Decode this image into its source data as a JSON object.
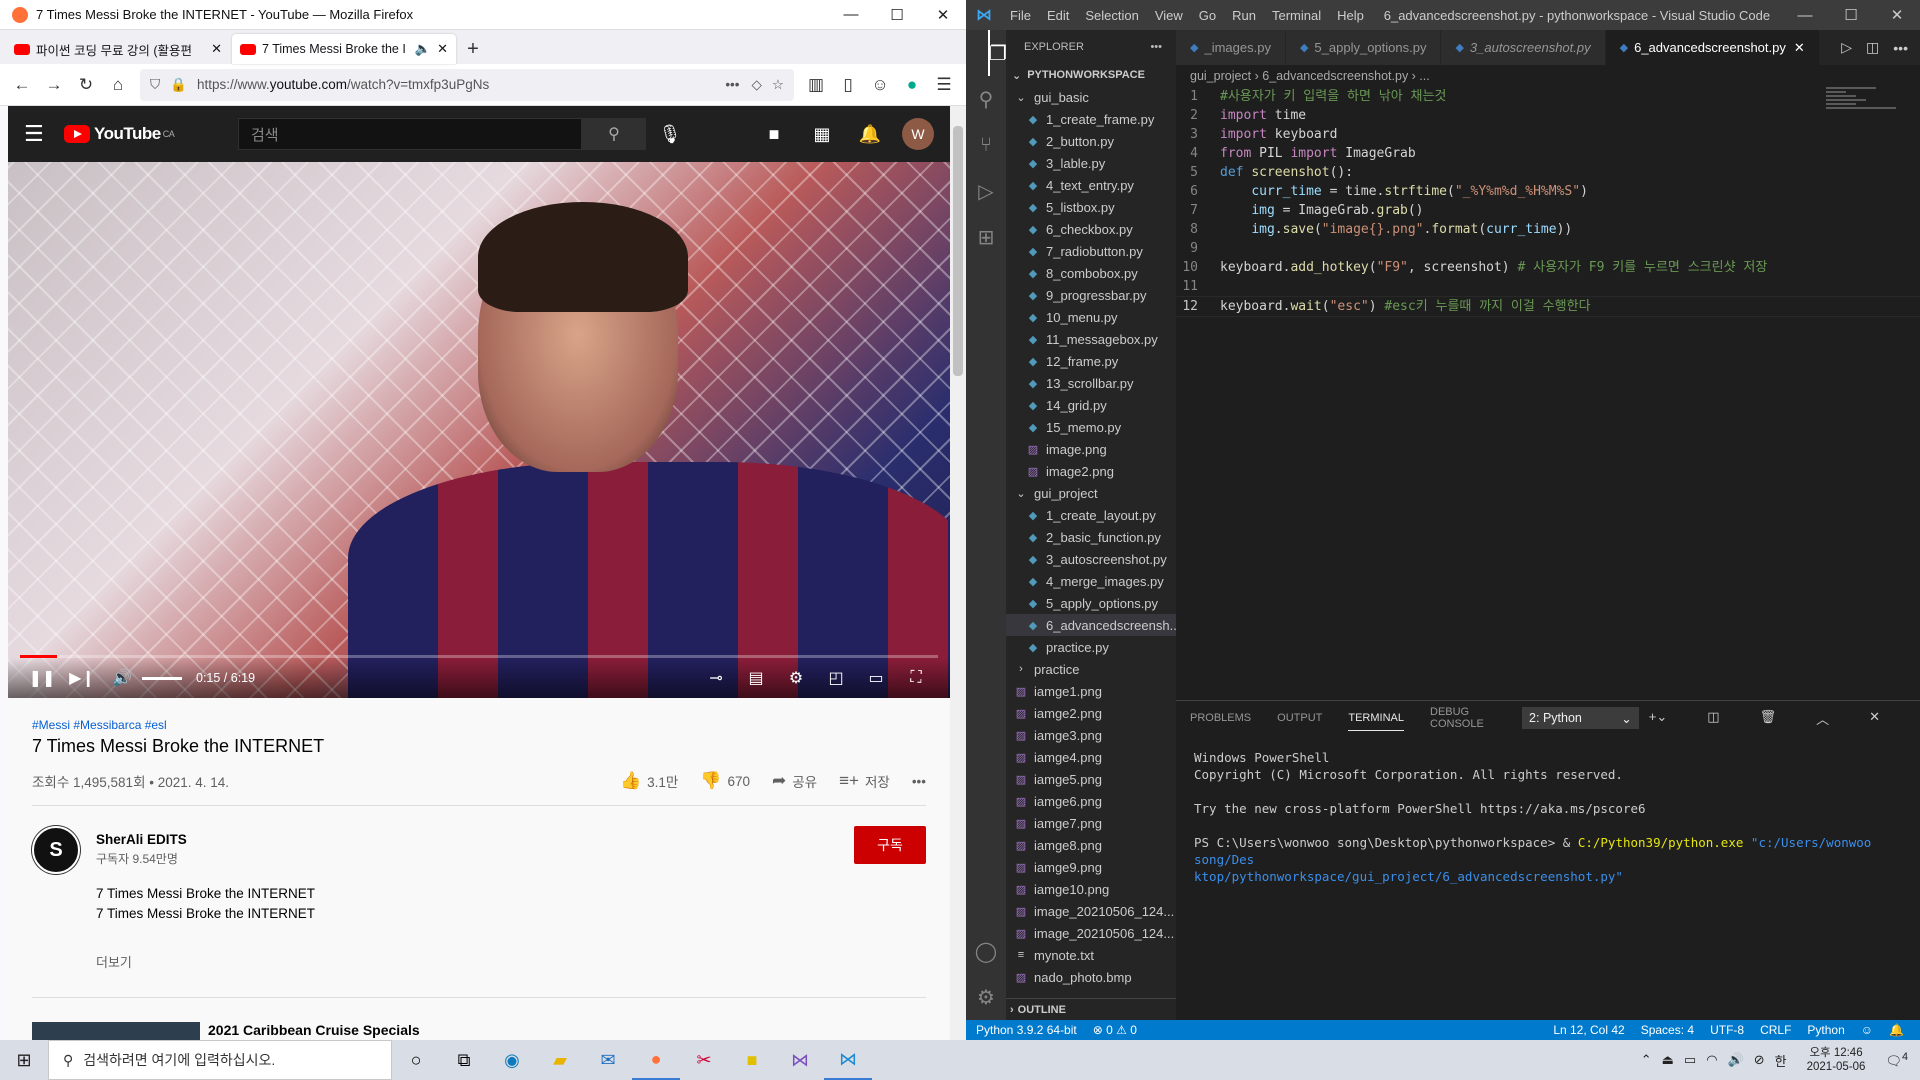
{
  "firefox": {
    "window_title": "7 Times Messi Broke the INTERNET - YouTube — Mozilla Firefox",
    "tabs": [
      {
        "label": "파이썬 코딩 무료 강의 (활용편"
      },
      {
        "label": "7 Times Messi Broke the I"
      }
    ],
    "url_prefix": "https://www.",
    "url_domain": "youtube.com",
    "url_path": "/watch?v=tmxfp3uPgNs"
  },
  "youtube": {
    "logo": "YouTube",
    "country": "CA",
    "search_placeholder": "검색",
    "avatar_letter": "W",
    "player": {
      "time": "0:15 / 6:19",
      "progress": 0.04
    },
    "tags": "#Messi #Messibarca #esl",
    "title": "7 Times Messi Broke the INTERNET",
    "views": "조회수 1,495,581회 • 2021. 4. 14.",
    "likes": "3.1만",
    "dislikes": "670",
    "share": "공유",
    "save": "저장",
    "channel_name": "SherAli EDITS",
    "subscribers": "구독자 9.54만명",
    "subscribe": "구독",
    "desc1": "7 Times Messi Broke the INTERNET",
    "desc2": "7 Times Messi Broke the INTERNET",
    "more": "더보기",
    "related_title": "2021 Caribbean Cruise Specials"
  },
  "vscode": {
    "window_title": "6_advancedscreenshot.py - pythonworkspace - Visual Studio Code",
    "menu": [
      "File",
      "Edit",
      "Selection",
      "View",
      "Go",
      "Run",
      "Terminal",
      "Help"
    ],
    "explorer_title": "EXPLORER",
    "workspace": "PYTHONWORKSPACE",
    "tree": [
      {
        "label": "gui_basic",
        "kind": "folder",
        "depth": 1
      },
      {
        "label": "1_create_frame.py",
        "kind": "py",
        "depth": 2
      },
      {
        "label": "2_button.py",
        "kind": "py",
        "depth": 2
      },
      {
        "label": "3_lable.py",
        "kind": "py",
        "depth": 2
      },
      {
        "label": "4_text_entry.py",
        "kind": "py",
        "depth": 2
      },
      {
        "label": "5_listbox.py",
        "kind": "py",
        "depth": 2
      },
      {
        "label": "6_checkbox.py",
        "kind": "py",
        "depth": 2
      },
      {
        "label": "7_radiobutton.py",
        "kind": "py",
        "depth": 2
      },
      {
        "label": "8_combobox.py",
        "kind": "py",
        "depth": 2
      },
      {
        "label": "9_progressbar.py",
        "kind": "py",
        "depth": 2
      },
      {
        "label": "10_menu.py",
        "kind": "py",
        "depth": 2
      },
      {
        "label": "11_messagebox.py",
        "kind": "py",
        "depth": 2
      },
      {
        "label": "12_frame.py",
        "kind": "py",
        "depth": 2
      },
      {
        "label": "13_scrollbar.py",
        "kind": "py",
        "depth": 2
      },
      {
        "label": "14_grid.py",
        "kind": "py",
        "depth": 2
      },
      {
        "label": "15_memo.py",
        "kind": "py",
        "depth": 2
      },
      {
        "label": "image.png",
        "kind": "img",
        "depth": 2
      },
      {
        "label": "image2.png",
        "kind": "img",
        "depth": 2
      },
      {
        "label": "gui_project",
        "kind": "folder",
        "depth": 1
      },
      {
        "label": "1_create_layout.py",
        "kind": "py",
        "depth": 2
      },
      {
        "label": "2_basic_function.py",
        "kind": "py",
        "depth": 2
      },
      {
        "label": "3_autoscreenshot.py",
        "kind": "py",
        "depth": 2
      },
      {
        "label": "4_merge_images.py",
        "kind": "py",
        "depth": 2
      },
      {
        "label": "5_apply_options.py",
        "kind": "py",
        "depth": 2
      },
      {
        "label": "6_advancedscreensh...",
        "kind": "py",
        "depth": 2,
        "selected": true
      },
      {
        "label": "practice.py",
        "kind": "py",
        "depth": 2
      },
      {
        "label": "practice",
        "kind": "folder-closed",
        "depth": 1
      },
      {
        "label": "iamge1.png",
        "kind": "img",
        "depth": 1
      },
      {
        "label": "iamge2.png",
        "kind": "img",
        "depth": 1
      },
      {
        "label": "iamge3.png",
        "kind": "img",
        "depth": 1
      },
      {
        "label": "iamge4.png",
        "kind": "img",
        "depth": 1
      },
      {
        "label": "iamge5.png",
        "kind": "img",
        "depth": 1
      },
      {
        "label": "iamge6.png",
        "kind": "img",
        "depth": 1
      },
      {
        "label": "iamge7.png",
        "kind": "img",
        "depth": 1
      },
      {
        "label": "iamge8.png",
        "kind": "img",
        "depth": 1
      },
      {
        "label": "iamge9.png",
        "kind": "img",
        "depth": 1
      },
      {
        "label": "iamge10.png",
        "kind": "img",
        "depth": 1
      },
      {
        "label": "image_20210506_124...",
        "kind": "img",
        "depth": 1
      },
      {
        "label": "image_20210506_124...",
        "kind": "img",
        "depth": 1
      },
      {
        "label": "mynote.txt",
        "kind": "txt",
        "depth": 1
      },
      {
        "label": "nado_photo.bmp",
        "kind": "img",
        "depth": 1
      }
    ],
    "outline": "OUTLINE",
    "editor_tabs": [
      {
        "label": "_images.py",
        "current": false,
        "italic": false
      },
      {
        "label": "5_apply_options.py",
        "current": false,
        "italic": false
      },
      {
        "label": "3_autoscreenshot.py",
        "current": false,
        "italic": true
      },
      {
        "label": "6_advancedscreenshot.py",
        "current": true,
        "italic": false
      }
    ],
    "breadcrumb": "gui_project  ›  6_advancedscreenshot.py  ›  ...",
    "code": [
      "#사용자가 키 입력을 하면 낚아 채는것",
      "import time",
      "import keyboard",
      "from PIL import ImageGrab",
      "def screenshot():",
      "    curr_time = time.strftime(\"_%Y%m%d_%H%M%S\")",
      "    img = ImageGrab.grab()",
      "    img.save(\"image{}.png\".format(curr_time))",
      "",
      "keyboard.add_hotkey(\"F9\", screenshot) # 사용자가 F9 키를 누르면 스크린샷 저장",
      "",
      "keyboard.wait(\"esc\") #esc키 누를때 까지 이걸 수행한다"
    ],
    "panel_tabs": [
      "PROBLEMS",
      "OUTPUT",
      "TERMINAL",
      "DEBUG CONSOLE"
    ],
    "terminal_select": "2: Python",
    "terminal": {
      "l1": "Windows PowerShell",
      "l2": "Copyright (C) Microsoft Corporation. All rights reserved.",
      "l3": "Try the new cross-platform PowerShell https://aka.ms/pscore6",
      "prompt": "PS C:\\Users\\wonwoo song\\Desktop\\pythonworkspace> & ",
      "exe": "C:/Python39/python.exe",
      "arg1": " \"c:/Users/wonwoo song/Des",
      "arg2": "ktop/pythonworkspace/gui_project/6_advancedscreenshot.py\""
    },
    "status": {
      "python": "Python 3.9.2 64-bit",
      "problems": "⊗ 0 ⚠ 0",
      "pos": "Ln 12, Col 42",
      "spaces": "Spaces: 4",
      "enc": "UTF-8",
      "eol": "CRLF",
      "lang": "Python"
    }
  },
  "taskbar": {
    "search": "검색하려면 여기에 입력하십시오.",
    "ime": "한",
    "time": "오후 12:46",
    "date": "2021-05-06",
    "notif": "4"
  }
}
